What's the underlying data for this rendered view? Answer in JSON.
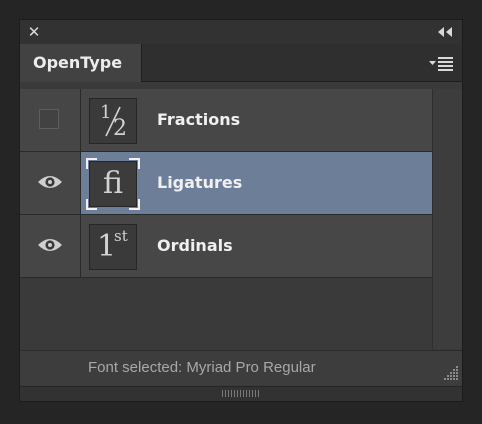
{
  "panel": {
    "close_symbol": "✕",
    "tab_label": "OpenType",
    "close_button": "close-icon",
    "collapse_button": "double-chevron-left-icon",
    "menu_button": "panel-menu-icon"
  },
  "features": [
    {
      "label": "Fractions",
      "glyph_num": "1",
      "glyph_den": "2",
      "visibility": "checkbox-unchecked",
      "selected": false
    },
    {
      "label": "Ligatures",
      "glyph": "fi",
      "visibility": "eye-icon",
      "selected": true
    },
    {
      "label": "Ordinals",
      "glyph": "1",
      "glyph_sup": "st",
      "visibility": "eye-icon",
      "selected": false
    }
  ],
  "status": {
    "text": "Font selected: Myriad Pro Regular"
  },
  "colors": {
    "selected_row": "#6c7e98",
    "panel_bg": "#3a3a3a",
    "row_bg": "#474747"
  }
}
